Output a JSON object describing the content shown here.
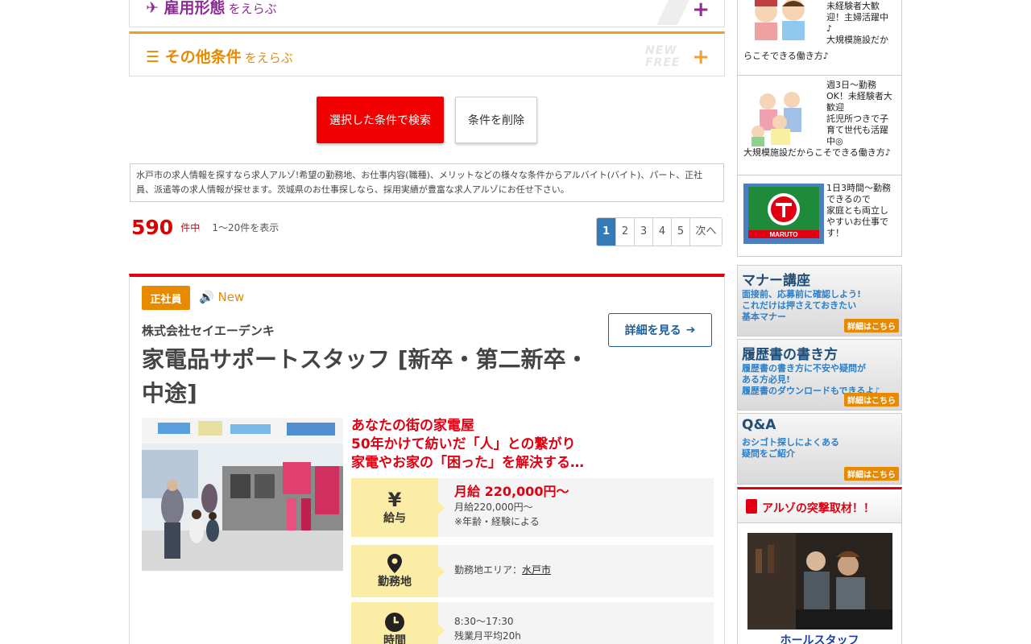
{
  "conditions": {
    "employment": {
      "title": "雇用形態",
      "sub": "をえらぶ"
    },
    "other": {
      "title": "その他条件",
      "sub": "をえらぶ",
      "badge_new": "NEW",
      "badge_free": "FREE"
    },
    "plus": "+"
  },
  "buttons": {
    "search": "選択した条件で検索",
    "clear": "条件を削除"
  },
  "description": "水戸市の求人情報を探すなら求人アルゾ!希望の勤務地、お仕事内容(職種)、メリットなどの様々な条件からアルバイト(バイト)、パート、正社員、派遣等の求人情報が探せます。茨城県のお仕事探しなら、採用実績が豊富な求人アルゾにお任せ下さい。",
  "results": {
    "count": "590",
    "unit": "件中",
    "range": "1〜20件を表示"
  },
  "pagination": {
    "pages": [
      "1",
      "2",
      "3",
      "4",
      "5"
    ],
    "active": "1",
    "next": "次へ"
  },
  "job": {
    "type_badge": "正社員",
    "new_label": "New",
    "company": "株式会社セイエーデンキ",
    "title": "家電品サポートスタッフ [新卒・第二新卒・中途]",
    "detail_button": "詳細を見る",
    "catch": [
      "あなたの街の家電屋",
      "50年かけて紡いだ「人」との繋がり",
      "家電やお家の「困った」を解決する…"
    ],
    "salary": {
      "label": "給与",
      "highlight": "月給 220,000円〜",
      "line1": "月給220,000円〜",
      "line2": "※年齢・経験による"
    },
    "area": {
      "label": "勤務地",
      "prefix": "勤務地エリア：",
      "link": "水戸市"
    },
    "time": {
      "label": "時間",
      "line1": "8:30〜17:30",
      "line2": "残業月平均20h"
    }
  },
  "sidebar": {
    "items": [
      {
        "lines": [
          "未経験者大歓",
          "迎！主婦活躍中",
          "♪",
          "大規模施設だか",
          "らこそできる働き方♪"
        ]
      },
      {
        "lines": [
          "週3日〜勤務",
          "OK！未経験者大",
          "歓迎",
          "託児所つきで子",
          "育て世代も活躍",
          "中◎",
          "大規模施設だからこそできる働き方♪"
        ]
      },
      {
        "lines": [
          "1日3時間〜勤務",
          "できるので",
          "家庭とも両立し",
          "やすいお仕事で",
          "す！"
        ],
        "logo_text": "MARUTO"
      }
    ],
    "banners": [
      {
        "title": "マナー講座",
        "lines": [
          "面接前、応募前に確認しよう!",
          "これだけは押さえておきたい",
          "基本マナー"
        ],
        "link": "詳細はこちら"
      },
      {
        "title": "履歴書の書き方",
        "lines": [
          "履歴書の書き方に不安や疑問が",
          "ある方必見!",
          "履歴書のダウンロードもできるよ♪"
        ],
        "link": "詳細はこちら"
      },
      {
        "title": "Q&A",
        "lines": [
          "おシゴト探しによくある",
          "疑問をご紹介"
        ],
        "link": "詳細はこちら"
      }
    ],
    "raid": {
      "title": "アルゾの突撃取材！！",
      "caption": "ホールスタッフ"
    }
  },
  "colors": {
    "accent_red": "#e00012",
    "orange": "#e88a00",
    "purple": "#8e2c96",
    "blue": "#337ab7",
    "yellow": "#fbeca6"
  }
}
